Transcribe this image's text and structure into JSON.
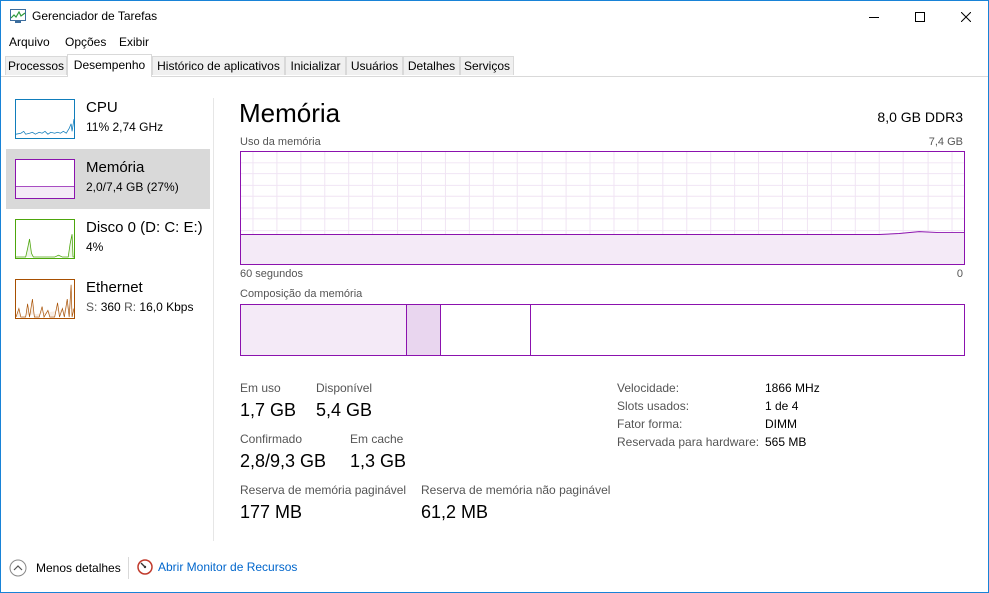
{
  "window": {
    "title": "Gerenciador de Tarefas",
    "app_icon": "task-manager-icon"
  },
  "menu": [
    "Arquivo",
    "Opções",
    "Exibir"
  ],
  "tabs": [
    "Processos",
    "Desempenho",
    "Histórico de aplicativos",
    "Inicializar",
    "Usuários",
    "Detalhes",
    "Serviços"
  ],
  "active_tab": "Desempenho",
  "sidebar": {
    "items": [
      {
        "title": "CPU",
        "sub": "11%  2,74 GHz",
        "color": "#117dbb"
      },
      {
        "title": "Memória",
        "sub": "2,0/7,4 GB (27%)",
        "color": "#8b12ae"
      },
      {
        "title": "Disco 0 (D: C: E:)",
        "sub": "4%",
        "color": "#4da60c"
      },
      {
        "title": "Ethernet",
        "sub_parts": [
          "S:",
          "360",
          "R:",
          "16,0 Kbps"
        ],
        "color": "#a74f01"
      }
    ],
    "selected": "Memória"
  },
  "main": {
    "title": "Memória",
    "spec": "8,0 GB DDR3",
    "usage_label": "Uso da memória",
    "usage_max": "7,4 GB",
    "time_label": "60 segundos",
    "time_end": "0",
    "composition_label": "Composição da memória",
    "usage_fraction": 0.27,
    "stats": {
      "in_use_label": "Em uso",
      "in_use": "1,7 GB",
      "available_label": "Disponível",
      "available": "5,4 GB",
      "committed_label": "Confirmado",
      "committed": "2,8/9,3 GB",
      "cached_label": "Em cache",
      "cached": "1,3 GB",
      "paged_label": "Reserva de memória paginável",
      "paged": "177 MB",
      "nonpaged_label": "Reserva de memória não paginável",
      "nonpaged": "61,2 MB"
    },
    "details": [
      {
        "label": "Velocidade:",
        "value": "1866 MHz"
      },
      {
        "label": "Slots usados:",
        "value": "1 de 4"
      },
      {
        "label": "Fator forma:",
        "value": "DIMM"
      },
      {
        "label": "Reservada para hardware:",
        "value": "565 MB"
      }
    ]
  },
  "footer": {
    "less_details": "Menos detalhes",
    "open_monitor": "Abrir Monitor de Recursos"
  },
  "colors": {
    "memory": "#8b12ae",
    "link": "#0066cc",
    "accent_border": "#1883d7"
  }
}
